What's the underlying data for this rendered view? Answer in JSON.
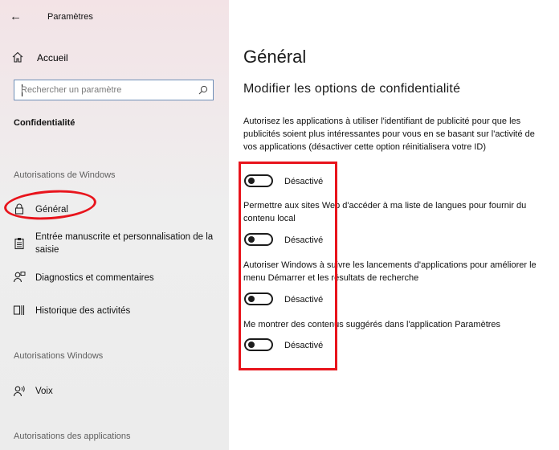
{
  "window": {
    "title": "Paramètres",
    "back_icon": "arrow-left-icon"
  },
  "sidebar": {
    "home_label": "Accueil",
    "home_icon": "home-icon",
    "search": {
      "placeholder": "Rechercher un paramètre",
      "icon": "search-icon"
    },
    "section_title": "Confidentialité",
    "group_windows": "Autorisations de Windows",
    "items": [
      {
        "label": "Général",
        "icon": "lock-icon",
        "selected": true
      },
      {
        "label": "Entrée manuscrite et personnalisation de la saisie",
        "icon": "clipboard-icon"
      },
      {
        "label": "Diagnostics et commentaires",
        "icon": "person-feedback-icon"
      },
      {
        "label": "Historique des activités",
        "icon": "timeline-icon"
      }
    ],
    "group_windows2": "Autorisations Windows",
    "items2": [
      {
        "label": "Voix",
        "icon": "speech-icon"
      }
    ],
    "group_apps": "Autorisations des applications"
  },
  "main": {
    "title": "Général",
    "subtitle": "Modifier les options de confidentialité",
    "options": [
      {
        "description": "Autorisez les applications à utiliser l'identifiant de publicité pour que les publicités soient plus intéressantes pour vous en se basant sur l'activité de vos applications (désactiver cette option réinitialisera votre ID)",
        "state": "Désactivé",
        "on": false
      },
      {
        "description": "Permettre aux sites Web d'accéder à ma liste de langues pour fournir du contenu local",
        "state": "Désactivé",
        "on": false
      },
      {
        "description": "Autoriser Windows à suivre les lancements d'applications pour améliorer le menu Démarrer et les résultats de recherche",
        "state": "Désactivé",
        "on": false
      },
      {
        "description": "Me montrer des contenus suggérés dans l'application Paramètres",
        "state": "Désactivé",
        "on": false
      }
    ]
  },
  "annotations": {
    "color": "#e8141c"
  }
}
